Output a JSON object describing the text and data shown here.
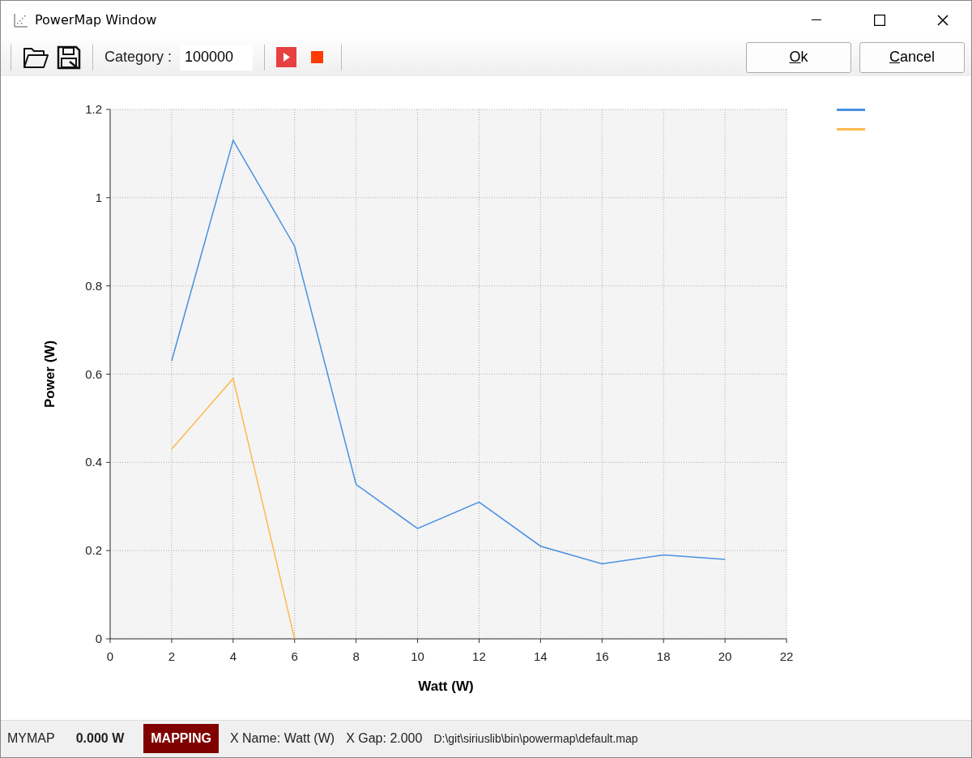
{
  "window": {
    "title": "PowerMap Window"
  },
  "toolbar": {
    "category_label": "Category :",
    "category_value": "100000",
    "buttons": [
      {
        "label": "Ok"
      },
      {
        "label": "Cancel"
      }
    ]
  },
  "chart": {
    "chart_data": {
      "type": "line",
      "grid": true,
      "xlabel": "Watt (W)",
      "ylabel": "Power (W)",
      "xlim": [
        0,
        22
      ],
      "ylim": [
        0,
        1.2
      ],
      "xticks": [
        0,
        2,
        4,
        6,
        8,
        10,
        12,
        14,
        16,
        18,
        20,
        22
      ],
      "yticks": [
        {
          "value": 0,
          "label": "0"
        },
        {
          "value": 0.2,
          "label": "0.2"
        },
        {
          "value": 0.4,
          "label": "0.4"
        },
        {
          "value": 0.6,
          "label": "0.6"
        },
        {
          "value": 0.8,
          "label": "0.8"
        },
        {
          "value": 1,
          "label": "1"
        },
        {
          "value": 1.2,
          "label": "1.2"
        }
      ],
      "x": [
        2,
        4,
        6,
        8,
        10,
        12,
        14,
        16,
        18,
        20
      ],
      "series": [
        {
          "color": "#4a90e2",
          "values": [
            0.63,
            1.13,
            0.89,
            0.35,
            0.25,
            0.31,
            0.21,
            0.17,
            0.19,
            0.18
          ]
        },
        {
          "color": "#ffb84d",
          "values": [
            0.43,
            0.59,
            0,
            null,
            null,
            null,
            null,
            null,
            null,
            null
          ]
        }
      ]
    }
  },
  "status_bar": {
    "map_name": "MYMAP",
    "power": "0.000 W",
    "mode": "MAPPING",
    "x_name": "X Name: Watt (W)",
    "x_gap": "X Gap: 2.000",
    "path": "D:\\git\\siriuslib\\bin\\powermap\\default.map"
  }
}
